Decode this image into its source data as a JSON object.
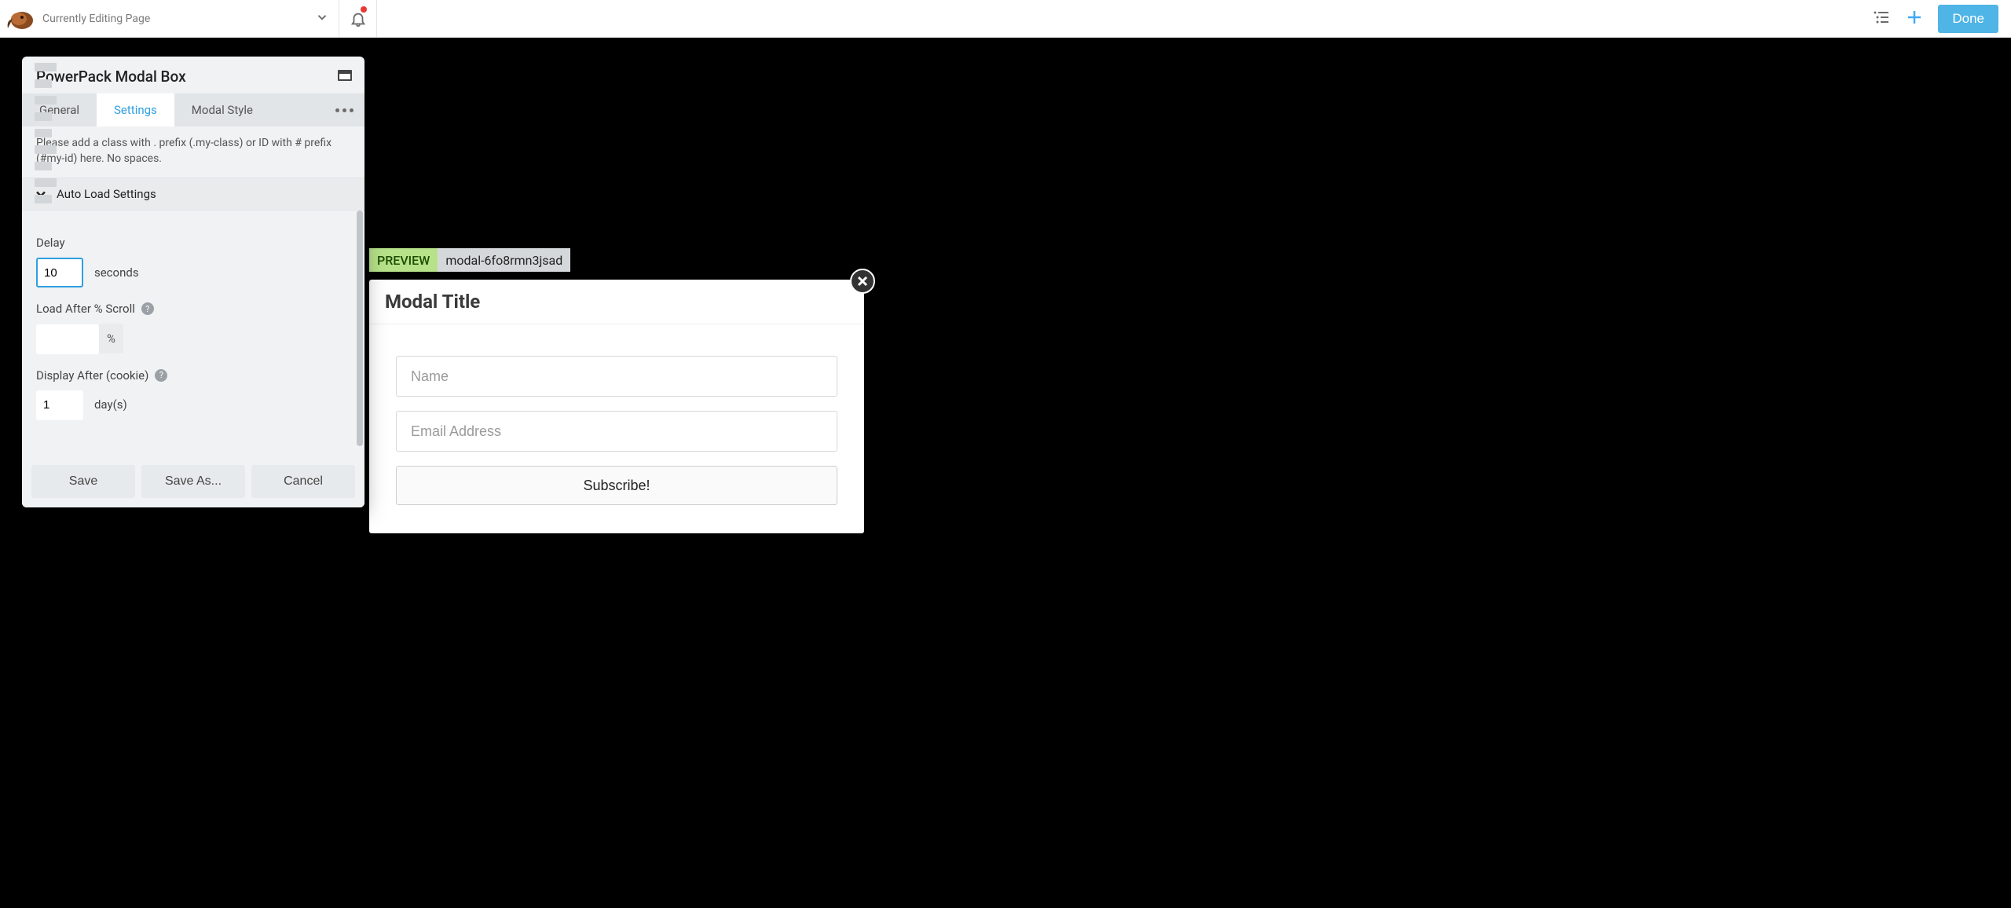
{
  "topbar": {
    "page_label": "Currently Editing Page",
    "done_label": "Done"
  },
  "panel": {
    "title": "PowerPack Modal Box",
    "tabs": {
      "general": "General",
      "settings": "Settings",
      "modal_style": "Modal Style"
    },
    "hint": "Please add a class with . prefix (.my-class) or ID with # prefix (#my-id) here. No spaces.",
    "section": {
      "auto_load": "Auto Load Settings"
    },
    "fields": {
      "delay_label": "Delay",
      "delay_value": "10",
      "delay_unit": "seconds",
      "scroll_label": "Load After % Scroll",
      "scroll_value": "",
      "scroll_unit": "%",
      "cookie_label": "Display After (cookie)",
      "cookie_value": "1",
      "cookie_unit": "day(s)"
    },
    "footer": {
      "save": "Save",
      "save_as": "Save As...",
      "cancel": "Cancel"
    }
  },
  "preview": {
    "badge": "PREVIEW",
    "identifier": "modal-6fo8rmn3jsad"
  },
  "modal": {
    "title": "Modal Title",
    "name_placeholder": "Name",
    "email_placeholder": "Email Address",
    "subscribe_label": "Subscribe!"
  }
}
